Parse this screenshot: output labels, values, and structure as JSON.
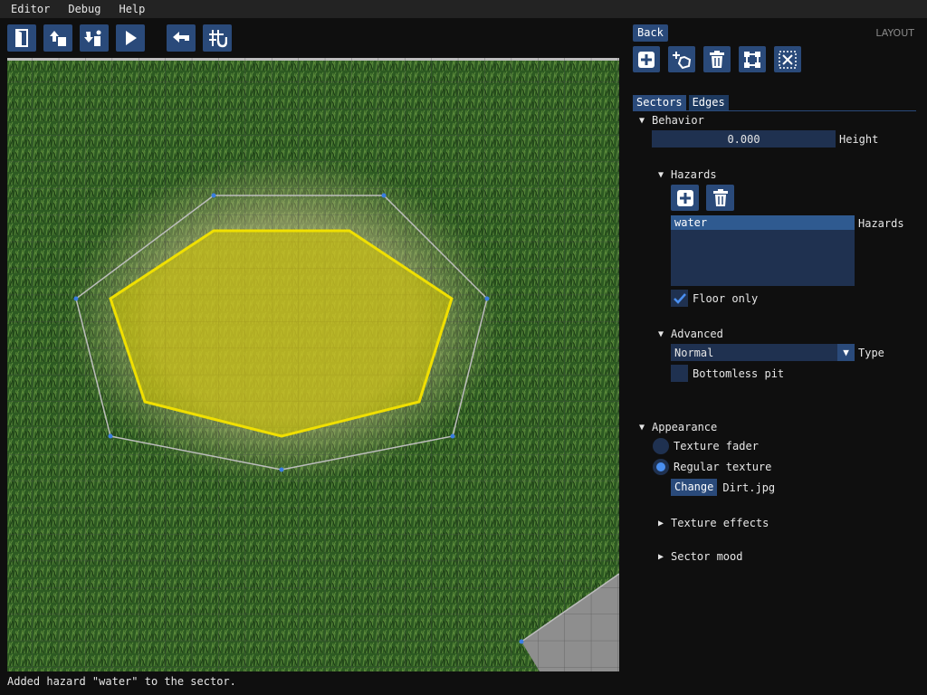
{
  "menu": [
    "Editor",
    "Debug",
    "Help"
  ],
  "toolbar": {
    "icons": [
      "exit-icon",
      "upload-icon",
      "import-icon",
      "play-icon",
      "undo-icon",
      "grid-snap-icon"
    ]
  },
  "panel": {
    "back_label": "Back",
    "layout_label": "LAYOUT",
    "tools": [
      "add-sector-icon",
      "add-circle-sector-icon",
      "delete-icon",
      "select-all-icon",
      "deselect-icon"
    ],
    "tabs": [
      "Sectors",
      "Edges"
    ],
    "behavior": {
      "header": "Behavior",
      "height_value": "0.000",
      "height_label": "Height",
      "hazards": {
        "header": "Hazards",
        "items": [
          "water"
        ],
        "list_label": "Hazards",
        "floor_only_label": "Floor only",
        "floor_only_checked": true
      },
      "advanced": {
        "header": "Advanced",
        "type_value": "Normal",
        "type_label": "Type",
        "bottomless_label": "Bottomless pit",
        "bottomless_checked": false
      }
    },
    "appearance": {
      "header": "Appearance",
      "texture_fader_label": "Texture fader",
      "regular_texture_label": "Regular texture",
      "selected": "regular",
      "change_label": "Change",
      "texture_file": "Dirt.jpg",
      "texture_effects_label": "Texture effects",
      "sector_mood_label": "Sector mood"
    }
  },
  "status": "Added hazard \"water\" to the sector.",
  "colors": {
    "accent": "#2a4a7a",
    "selection": "#e6d400",
    "vertex": "#3a7de0"
  }
}
